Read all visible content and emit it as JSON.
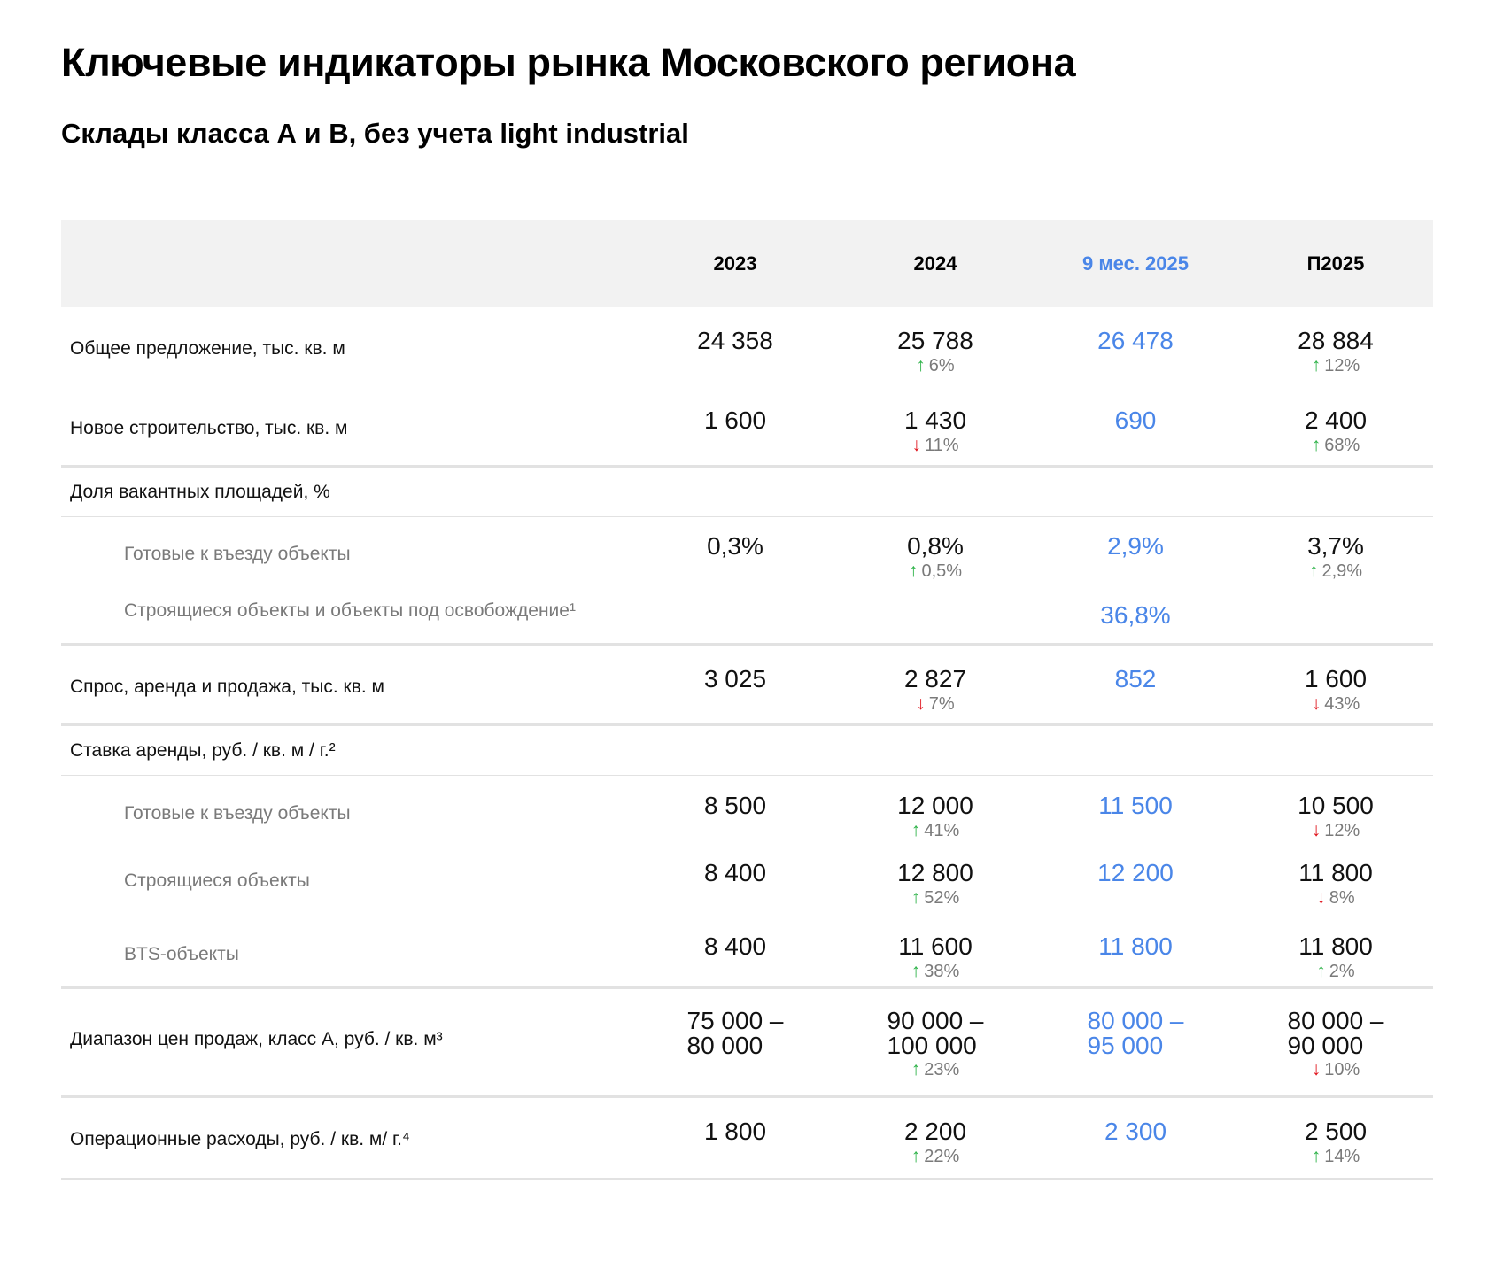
{
  "title": "Ключевые индикаторы рынка Московского региона",
  "subtitle": "Склады класса А и В, без учета light industrial",
  "colors": {
    "accent_blue": "#4a86e8",
    "up_green": "#2fb34a",
    "down_red": "#e0141d",
    "header_bg": "#f2f2f2"
  },
  "columns": [
    "2023",
    "2024",
    "9 мес. 2025",
    "П2025"
  ],
  "rows": {
    "supply": {
      "label": "Общее предложение, тыс. кв. м",
      "v2023": "24 358",
      "v2024": "25 788",
      "c2024": "6%",
      "v9m": "26 478",
      "vp2025": "28 884",
      "cp2025": "12%"
    },
    "construction": {
      "label": "Новое строительство, тыс. кв. м",
      "v2023": "1 600",
      "v2024": "1 430",
      "c2024": "11%",
      "v9m": "690",
      "vp2025": "2 400",
      "cp2025": "68%"
    },
    "vacancy": {
      "label": "Доля вакантных площадей, %",
      "ready": {
        "label": "Готовые к въезду объекты",
        "v2023": "0,3%",
        "v2024": "0,8%",
        "c2024": "0,5%",
        "v9m": "2,9%",
        "vp2025": "3,7%",
        "cp2025": "2,9%"
      },
      "building": {
        "label": "Строящиеся объекты и объекты под освобождение¹",
        "v9m": "36,8%"
      }
    },
    "demand": {
      "label": "Спрос, аренда и продажа, тыс. кв. м",
      "v2023": "3 025",
      "v2024": "2 827",
      "c2024": "7%",
      "v9m": "852",
      "vp2025": "1 600",
      "cp2025": "43%"
    },
    "rent": {
      "label": "Ставка аренды, руб. / кв. м / г.²",
      "ready": {
        "label": "Готовые к въезду объекты",
        "v2023": "8 500",
        "v2024": "12 000",
        "c2024": "41%",
        "v9m": "11 500",
        "vp2025": "10 500",
        "cp2025": "12%"
      },
      "building": {
        "label": "Строящиеся объекты",
        "v2023": "8 400",
        "v2024": "12 800",
        "c2024": "52%",
        "v9m": "12 200",
        "vp2025": "11 800",
        "cp2025": "8%"
      },
      "bts": {
        "label": "BTS-объекты",
        "v2023": "8 400",
        "v2024": "11 600",
        "c2024": "38%",
        "v9m": "11 800",
        "vp2025": "11 800",
        "cp2025": "2%"
      }
    },
    "prices": {
      "label": "Диапазон цен продаж, класс А, руб. / кв. м³",
      "v2023_a": "75 000 –",
      "v2023_b": "80 000",
      "v2024_a": "90 000 –",
      "v2024_b": "100 000",
      "c2024": "23%",
      "v9m_a": "80 000 –",
      "v9m_b": "95 000",
      "vp2025_a": "80 000 –",
      "vp2025_b": "90 000",
      "cp2025": "10%"
    },
    "opex": {
      "label": "Операционные расходы, руб. / кв. м/ г.⁴",
      "v2023": "1 800",
      "v2024": "2 200",
      "c2024": "22%",
      "v9m": "2 300",
      "vp2025": "2 500",
      "cp2025": "14%"
    }
  }
}
